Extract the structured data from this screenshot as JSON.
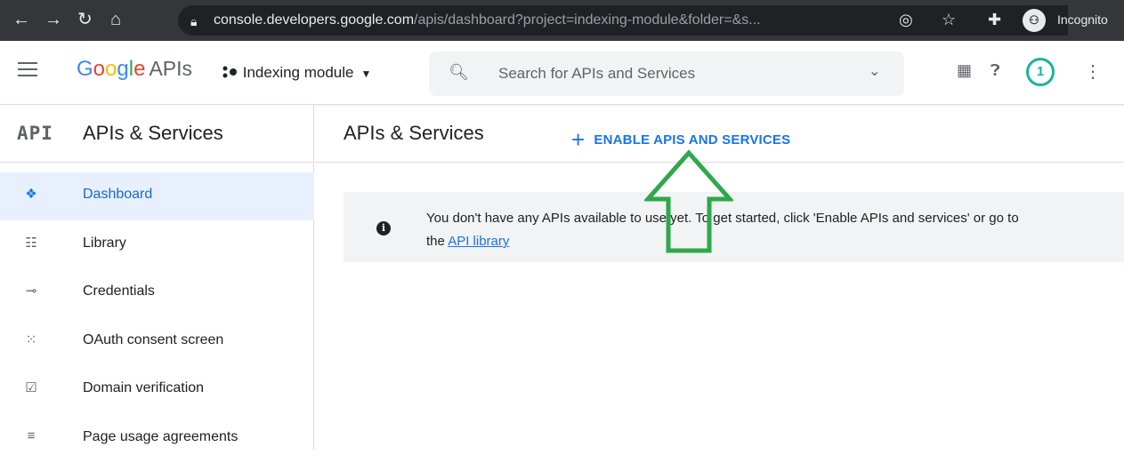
{
  "browser": {
    "url_host": "console.developers.google.com",
    "url_path": "/apis/dashboard?project=indexing-module&folder=&s...",
    "incognito_label": "Incognito"
  },
  "header": {
    "logo_google": "Google",
    "logo_apis": "APIs",
    "project_name": "Indexing module",
    "search_placeholder": "Search for APIs and Services",
    "notification_count": "1"
  },
  "sidebar": {
    "api_badge": "API",
    "title": "APIs & Services",
    "items": [
      {
        "label": "Dashboard",
        "icon": "dashboard-icon",
        "active": true
      },
      {
        "label": "Library",
        "icon": "library-icon"
      },
      {
        "label": "Credentials",
        "icon": "key-icon"
      },
      {
        "label": "OAuth consent screen",
        "icon": "consent-icon"
      },
      {
        "label": "Domain verification",
        "icon": "checkbox-icon"
      },
      {
        "label": "Page usage agreements",
        "icon": "settings-list-icon"
      }
    ]
  },
  "main": {
    "title": "APIs & Services",
    "enable_button": "ENABLE APIS AND SERVICES",
    "banner_text": "You don't have any APIs available to use yet. To get started, click 'Enable APIs and services' or go to",
    "banner_text_2": "the",
    "banner_link": "API library"
  },
  "colors": {
    "accent": "#1a73e8",
    "annotation_arrow": "#2ea84a",
    "chrome_bg": "#35363a"
  }
}
